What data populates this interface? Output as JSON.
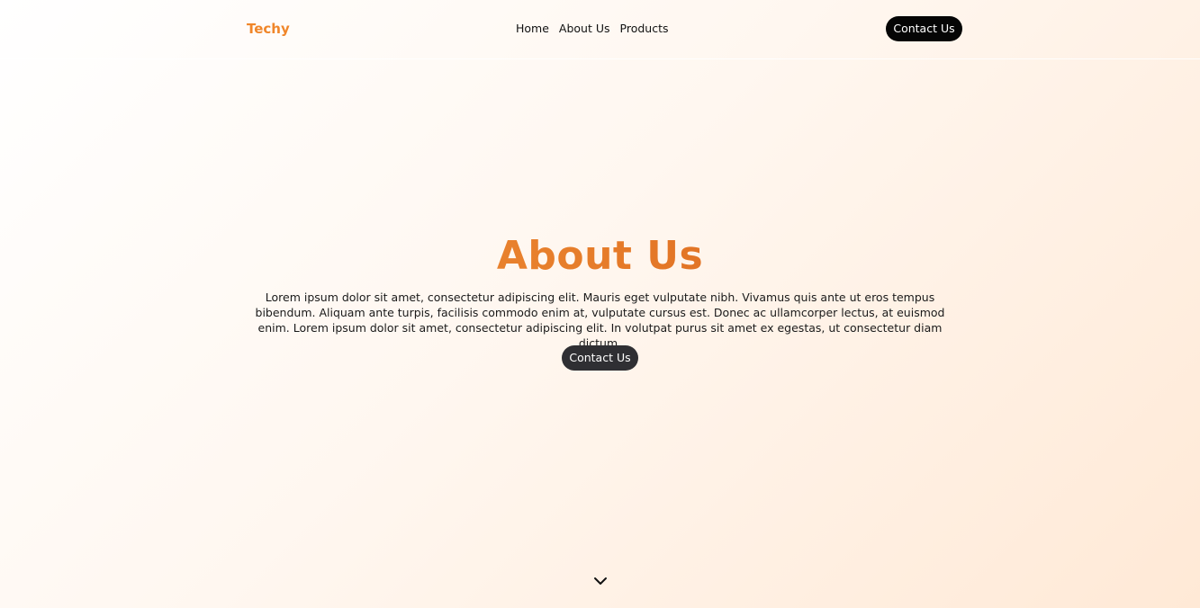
{
  "brand": "Techy",
  "nav": {
    "links": [
      "Home",
      "About Us",
      "Products"
    ],
    "contact_label": "Contact Us"
  },
  "hero": {
    "title": "About Us",
    "text": "Lorem ipsum dolor sit amet, consectetur adipiscing elit. Mauris eget vulputate nibh. Vivamus quis ante ut eros tempus bibendum. Aliquam ante turpis, facilisis commodo enim at, vulputate cursus est. Donec ac ullamcorper lectus, at euismod enim. Lorem ipsum dolor sit amet, consectetur adipiscing elit. In volutpat purus sit amet ex egestas, ut consectetur diam dictum.",
    "cta_label": "Contact Us"
  },
  "icons": {
    "scroll": "chevron-down-icon"
  },
  "colors": {
    "brand": "#f0862a",
    "title_gradient_start": "#f39b3d",
    "title_gradient_end": "#cf4f12",
    "button_dark": "#050505",
    "hero_button": "#2f2f33"
  }
}
